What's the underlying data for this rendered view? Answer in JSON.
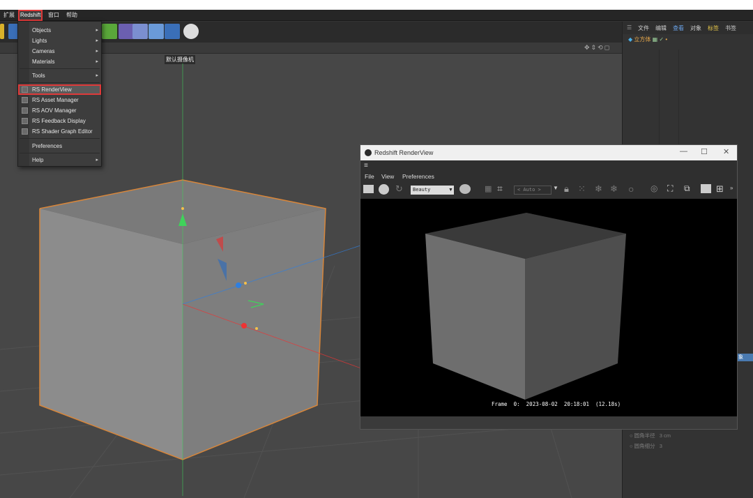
{
  "menubar": {
    "items": [
      "扩展",
      "Redshift",
      "窗口",
      "帮助"
    ]
  },
  "viewport": {
    "camera_label": "默认摄像机"
  },
  "dropdown": {
    "items": [
      {
        "label": "Objects",
        "submenu": true
      },
      {
        "label": "Lights",
        "submenu": true
      },
      {
        "label": "Cameras",
        "submenu": true
      },
      {
        "label": "Materials",
        "submenu": true
      },
      {
        "label": "Tools",
        "submenu": true
      },
      {
        "label": "RS RenderView",
        "submenu": false,
        "highlighted": true
      },
      {
        "label": "RS Asset Manager",
        "submenu": false
      },
      {
        "label": "RS AOV Manager",
        "submenu": false
      },
      {
        "label": "RS Feedback Display",
        "submenu": false
      },
      {
        "label": "RS Shader Graph Editor",
        "submenu": false
      },
      {
        "label": "Preferences",
        "submenu": false
      },
      {
        "label": "Help",
        "submenu": true
      }
    ],
    "submenu_arrow": "▸"
  },
  "right_panel": {
    "tabs": [
      "文件",
      "编辑",
      "查看",
      "对象",
      "标签",
      "书签"
    ],
    "object_name": "立方体",
    "attr_rows": [
      {
        "label": "圆角半径",
        "value": "3 cm"
      },
      {
        "label": "圆角细分",
        "value": "3"
      }
    ],
    "side_tab": "象"
  },
  "render_window": {
    "title": "Redshift RenderView",
    "menu": [
      "File",
      "View",
      "Preferences"
    ],
    "aov_select": "Beauty",
    "auto_select": "< Auto >",
    "frame_info": "Frame  0:  2023-08-02  20:18:01  (12.18s)",
    "window_controls": [
      "—",
      "☐",
      "✕"
    ]
  },
  "colors": {
    "accent_red": "#e03a3a",
    "selection_orange": "#d8863a",
    "axis_green": "#3fd35a",
    "axis_red": "#e33",
    "axis_blue": "#2f7fe0"
  }
}
